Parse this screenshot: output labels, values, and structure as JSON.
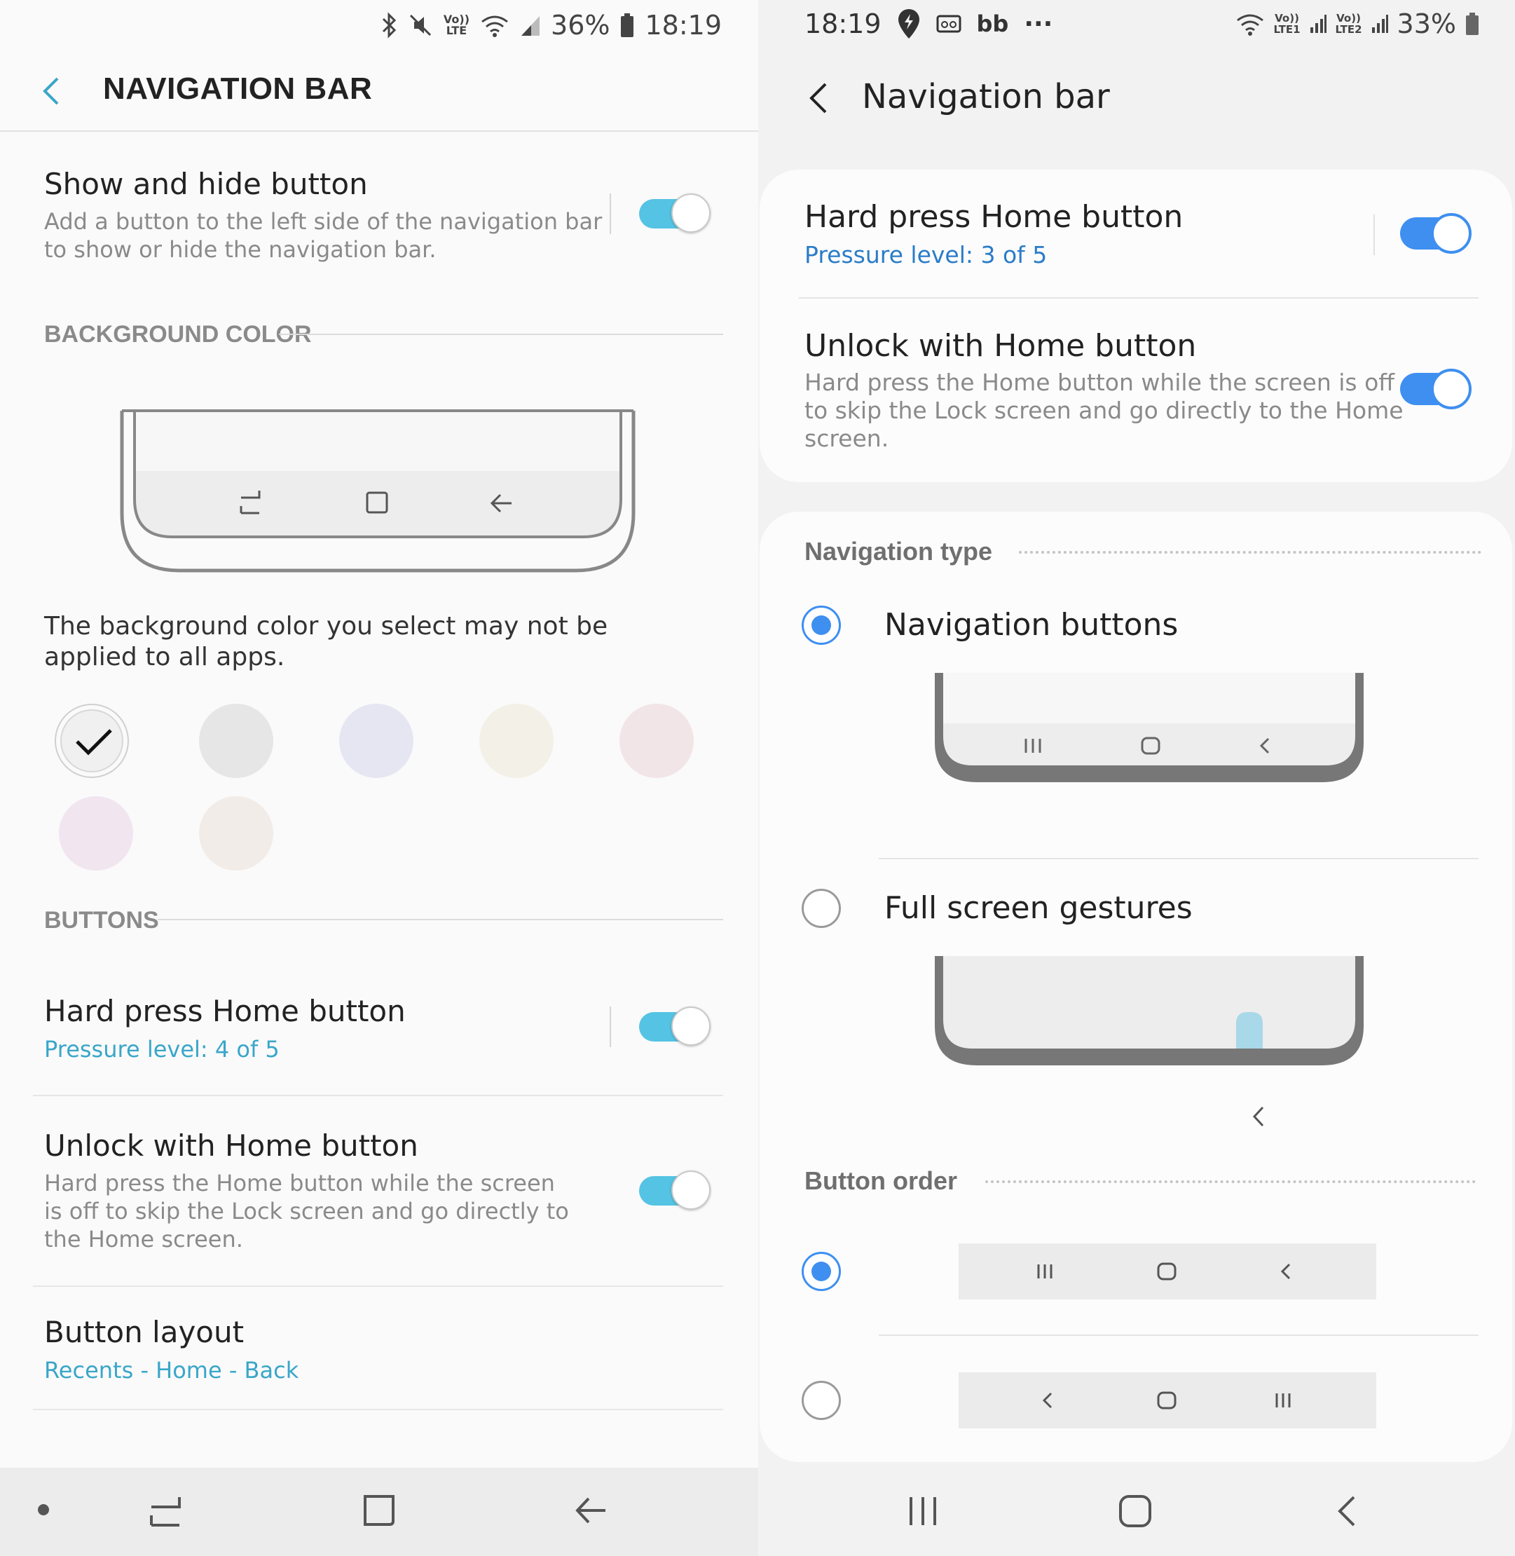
{
  "left": {
    "status": {
      "battery": "36%",
      "time": "18:19",
      "volte": "Vo))",
      "lte": "LTE"
    },
    "header": {
      "title": "NAVIGATION BAR"
    },
    "show_hide": {
      "title": "Show and hide button",
      "desc_line1": "Add a button to the left side of the navigation bar",
      "desc_line2": "to show or hide the navigation bar.",
      "enabled": true
    },
    "background_color": {
      "section": "BACKGROUND COLOR",
      "note_line1": "The background color you select may not be",
      "note_line2": "applied to all apps.",
      "swatches": [
        "#f0f0f0",
        "#e6e6e6",
        "#e6e6f3",
        "#f3f0e8",
        "#f1e5e7",
        "#f1e5f0",
        "#f2ece8"
      ],
      "selected": 0
    },
    "buttons": {
      "section": "BUTTONS",
      "hard_press": {
        "title": "Hard press Home button",
        "value": "Pressure level: 4 of 5",
        "enabled": true
      },
      "unlock": {
        "title": "Unlock with Home button",
        "desc_line1": "Hard press the Home button while the screen",
        "desc_line2": "is off to skip the Lock screen and go directly to",
        "desc_line3": "the Home screen.",
        "enabled": true
      },
      "layout": {
        "title": "Button layout",
        "value": "Recents - Home - Back"
      }
    },
    "accent_color": "#3aa6c9",
    "toggle_color": "#55c3e3"
  },
  "right": {
    "status": {
      "time": "18:19",
      "battery": "33%",
      "volte1": "Vo))",
      "lte1": "LTE1",
      "volte2": "Vo))",
      "lte2": "LTE2",
      "app_letters": "bb",
      "more": "···"
    },
    "header": {
      "title": "Navigation bar"
    },
    "hard_press": {
      "title": "Hard press Home button",
      "value": "Pressure level: 3 of 5",
      "enabled": true
    },
    "unlock": {
      "title": "Unlock with Home button",
      "desc_line1": "Hard press the Home button while the screen is off",
      "desc_line2": "to skip the Lock screen and go directly to the Home",
      "desc_line3": "screen.",
      "enabled": true
    },
    "navigation_type": {
      "section": "Navigation type",
      "options": [
        "Navigation buttons",
        "Full screen gestures"
      ],
      "selected": 0
    },
    "button_order": {
      "section": "Button order",
      "options": [
        [
          "recents",
          "home",
          "back"
        ],
        [
          "back",
          "home",
          "recents"
        ]
      ],
      "selected": 0
    },
    "accent_color": "#3e8ff0",
    "value_color": "#2a7cc8"
  }
}
